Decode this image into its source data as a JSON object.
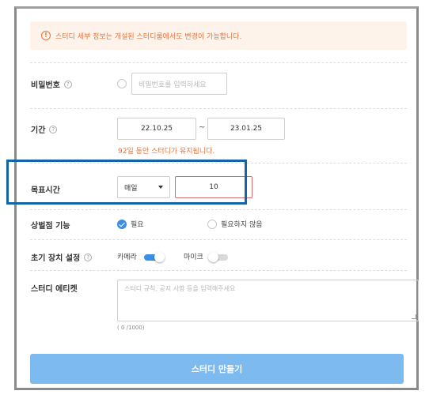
{
  "notice": {
    "icon": "info-icon",
    "text": "스터디 세부 정보는 개설된 스터디룸에서도 변경이 가능합니다."
  },
  "password": {
    "label": "비밀번호",
    "placeholder": "비밀번호를 입력하세요"
  },
  "period": {
    "label": "기간",
    "start": "22.10.25",
    "separator": "~",
    "end": "23.01.25",
    "hint": "92일 동안 스터디가 유지됩니다."
  },
  "goal_time": {
    "label": "목표시간",
    "frequency": "매일",
    "value": "10"
  },
  "penalty": {
    "label": "상벌점 기능",
    "options": [
      "필요",
      "필요하지 않음"
    ],
    "selected": "필요"
  },
  "device": {
    "label": "초기 장치 설정",
    "camera_label": "카메라",
    "camera_on": true,
    "mic_label": "마이크",
    "mic_on": false
  },
  "etiquette": {
    "label": "스터디 에티켓",
    "placeholder": "스터디 규칙, 공지 사항 등을 입력해주세요",
    "counter": "( 0 /1000)"
  },
  "submit_label": "스터디 만들기",
  "colors": {
    "accent": "#3a8ee6",
    "submit": "#7cbaf0",
    "warning": "#e8743b",
    "highlight": "#1464a8"
  }
}
